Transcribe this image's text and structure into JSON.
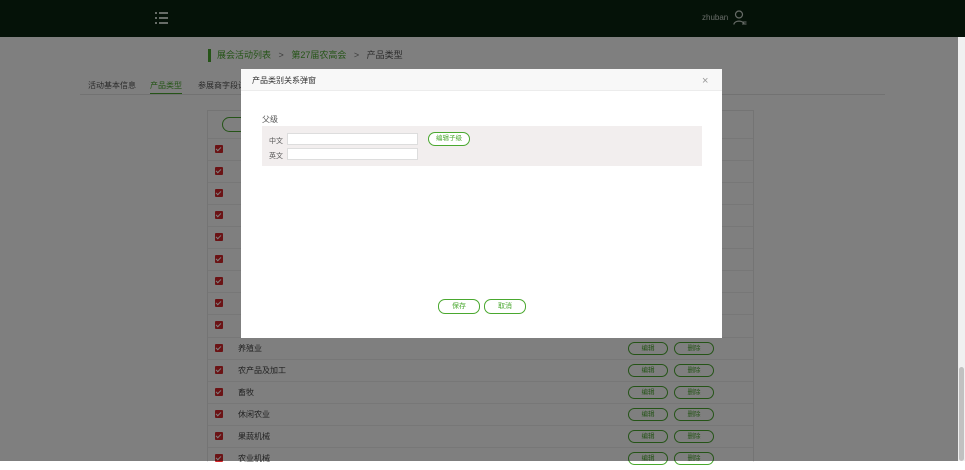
{
  "header": {
    "username": "zhuban"
  },
  "breadcrumb": {
    "items": [
      "展会活动列表",
      "第27届农高会"
    ],
    "separator": ">",
    "current": "产品类型"
  },
  "tabs": [
    "活动基本信息",
    "产品类型",
    "参展商字段设"
  ],
  "table": {
    "edit_label": "编辑",
    "delete_label": "删除",
    "rows": [
      "养殖业",
      "农产品及加工",
      "畜牧",
      "休闲农业",
      "果蔬机械",
      "农业机械"
    ]
  },
  "modal": {
    "title": "产品类别关系弹窗",
    "close": "×",
    "parent_label": "父级",
    "zh_label": "中文",
    "en_label": "英文",
    "zh_value": "",
    "en_value": "",
    "add_child_label": "编辑子级",
    "save_label": "保存",
    "cancel_label": "取消"
  },
  "colors": {
    "accent": "#4aa82f",
    "topbar": "#0b2411",
    "checkbox": "#d6262b"
  }
}
